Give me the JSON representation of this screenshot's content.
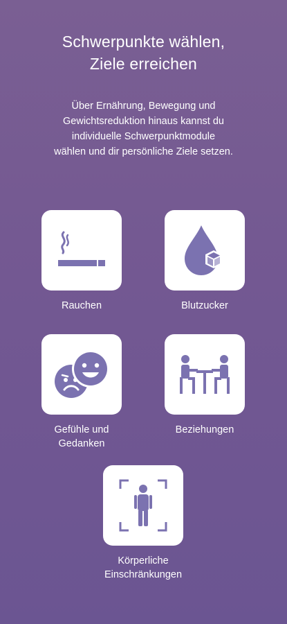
{
  "header": {
    "title": "Schwerpunkte wählen,\nZiele erreichen",
    "description": "Über Ernährung, Bewegung und\nGewichtsreduktion hinaus kannst du\nindividuelle Schwerpunktmodule\nwählen und dir persönliche Ziele setzen."
  },
  "modules": [
    {
      "label": "Rauchen",
      "icon": "cigarette-icon"
    },
    {
      "label": "Blutzucker",
      "icon": "blood-drop-sugar-icon"
    },
    {
      "label": "Gefühle und\nGedanken",
      "icon": "faces-emotions-icon"
    },
    {
      "label": "Beziehungen",
      "icon": "people-at-table-icon"
    },
    {
      "label": "Körperliche\nEinschränkungen",
      "icon": "person-frame-icon"
    }
  ],
  "colors": {
    "background_top": "#7a5f93",
    "background_bottom": "#6b5592",
    "icon_color": "#7b72b0",
    "tile": "#ffffff"
  }
}
